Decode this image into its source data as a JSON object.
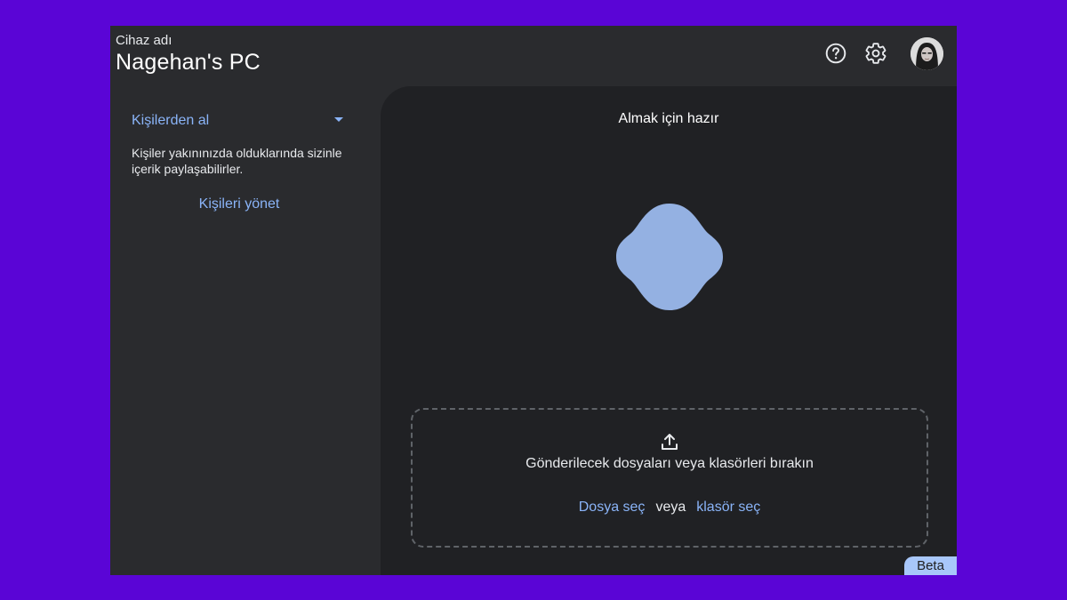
{
  "header": {
    "device_label": "Cihaz adı",
    "device_name": "Nagehan's PC",
    "help_icon": "help-circle-icon",
    "settings_icon": "gear-icon"
  },
  "sidebar": {
    "visibility_label": "Kişilerden al",
    "visibility_description": "Kişiler yakınınızda olduklarında sizinle içerik paylaşabilirler.",
    "manage_contacts": "Kişileri yönet"
  },
  "main": {
    "status_title": "Almak için hazır",
    "drop_zone": {
      "icon": "upload-icon",
      "text": "Gönderilecek dosyaları veya klasörleri bırakın",
      "choose_file": "Dosya seç",
      "or": "veya",
      "choose_folder": "klasör seç"
    }
  },
  "badge": "Beta",
  "colors": {
    "background": "#5a05d6",
    "window": "#2a2b2e",
    "panel": "#202124",
    "accent": "#8ab4f8",
    "shape": "#94b1e2",
    "badge": "#a8c7fa"
  }
}
